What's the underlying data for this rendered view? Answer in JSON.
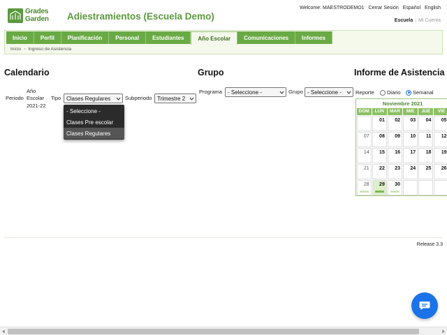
{
  "brand": {
    "logo_line1": "Grades",
    "logo_line2": "Garden",
    "app_title": "Adiestramientos (Escuela Demo)"
  },
  "top_links": {
    "welcome": "Welcome: MAESTRODEMO1",
    "logout": "Cerrar Sesión",
    "lang_es": "Español",
    "lang_en": "English"
  },
  "account": {
    "school": "Escuela",
    "sep": "|",
    "my_account": "Mi Cuenta"
  },
  "nav": {
    "tabs": [
      "Inicio",
      "Perfil",
      "Planificación",
      "Personal",
      "Estudiantes",
      "Año Escolar",
      "Comunicaciones",
      "Informes"
    ],
    "active": "Año Escolar"
  },
  "breadcrumb": {
    "home": "Inicio",
    "arrow": "›",
    "current": "Ingreso de Asistencia"
  },
  "calendario": {
    "title": "Calendario",
    "periodo_label": "Periodo",
    "periodo_value_1": "Año",
    "periodo_value_2": "Escolar",
    "periodo_value_3": "2021-22",
    "tipo_label": "Tipo",
    "tipo_selected": "Clases Regulares",
    "tipo_options": [
      "- Seleccione -",
      "Clases Pre escolar",
      "Clases Regulares"
    ],
    "subperiodo_label": "Subperiodo",
    "subperiodo_selected": "Trimestre 2"
  },
  "grupo": {
    "title": "Grupo",
    "programa_label": "Programa",
    "programa_selected": "- Seleccione -",
    "grupo_label": "Grupo",
    "grupo_selected": "- Seleccione -"
  },
  "informe": {
    "title": "Informe de Asistencia",
    "reporte_label": "Reporte",
    "option_diario": "Diario",
    "option_semanal": "Semanal",
    "selected": "Semanal"
  },
  "calendar": {
    "month": "Noviembre 2021",
    "weekdays": [
      "DOM",
      "LUN",
      "MAR",
      "MIE",
      "JUE",
      "VIE"
    ],
    "weeks": [
      [
        "",
        "01",
        "02",
        "03",
        "04",
        "05"
      ],
      [
        "07",
        "08",
        "09",
        "10",
        "11",
        "12"
      ],
      [
        "14",
        "15",
        "16",
        "17",
        "18",
        "19"
      ],
      [
        "21",
        "22",
        "23",
        "24",
        "25",
        "26"
      ],
      [
        "28",
        "29",
        "30",
        "",
        "",
        ""
      ]
    ],
    "today": "29"
  },
  "footer": {
    "release": "Release 3.3"
  },
  "colors": {
    "brand_green": "#5a9a3e",
    "tab_green": "#6aaa45",
    "chat_blue": "#1a73e8"
  }
}
